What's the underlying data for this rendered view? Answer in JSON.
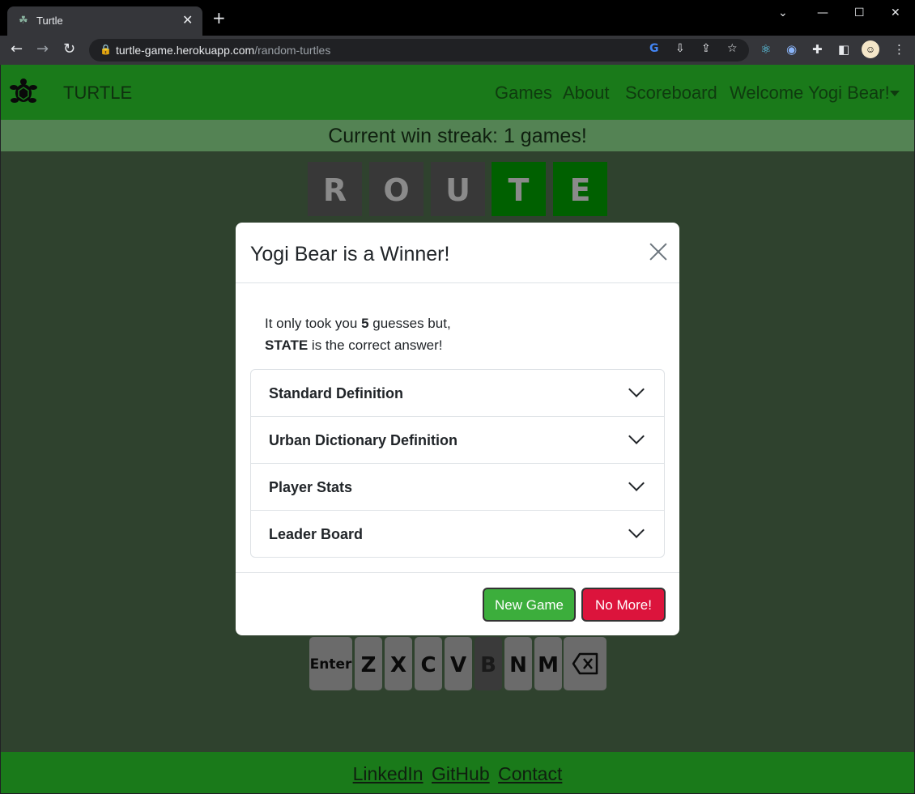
{
  "browser": {
    "tab_title": "Turtle",
    "tab_close": "✕",
    "new_tab": "+",
    "url_host": "turtle-game.herokuapp.com",
    "url_path": "/random-turtles"
  },
  "nav": {
    "brand": "TURTLE",
    "links": [
      "Games",
      "About",
      "Scoreboard",
      "Welcome Yogi Bear!"
    ]
  },
  "streak_text": "Current win streak: 1 games!",
  "guess": {
    "letters": [
      "R",
      "O",
      "U",
      "T",
      "E"
    ],
    "states": [
      "absent",
      "absent",
      "absent",
      "correct",
      "correct"
    ]
  },
  "keyboard": {
    "keys": [
      "Enter",
      "Z",
      "X",
      "C",
      "V",
      "B",
      "N",
      "M"
    ],
    "used_key": "B"
  },
  "footer": {
    "links": [
      "LinkedIn",
      "GitHub",
      "Contact"
    ]
  },
  "modal": {
    "title": "Yogi Bear is a Winner!",
    "msg_prefix": "It only took you ",
    "guess_count": "5",
    "msg_suffix": " guesses but,",
    "answer": "STATE",
    "answer_suffix": " is the correct answer!",
    "sections": [
      "Standard Definition",
      "Urban Dictionary Definition",
      "Player Stats",
      "Leader Board"
    ],
    "new_game_label": "New Game",
    "no_more_label": "No More!"
  },
  "colors": {
    "nav_green": "#1a7a1a",
    "page_bg": "#2f422e",
    "streak_bg": "#548354",
    "tile_correct": "#006000",
    "tile_absent": "#383838",
    "btn_new": "#3cae3c",
    "btn_no_more": "#dc143c"
  }
}
